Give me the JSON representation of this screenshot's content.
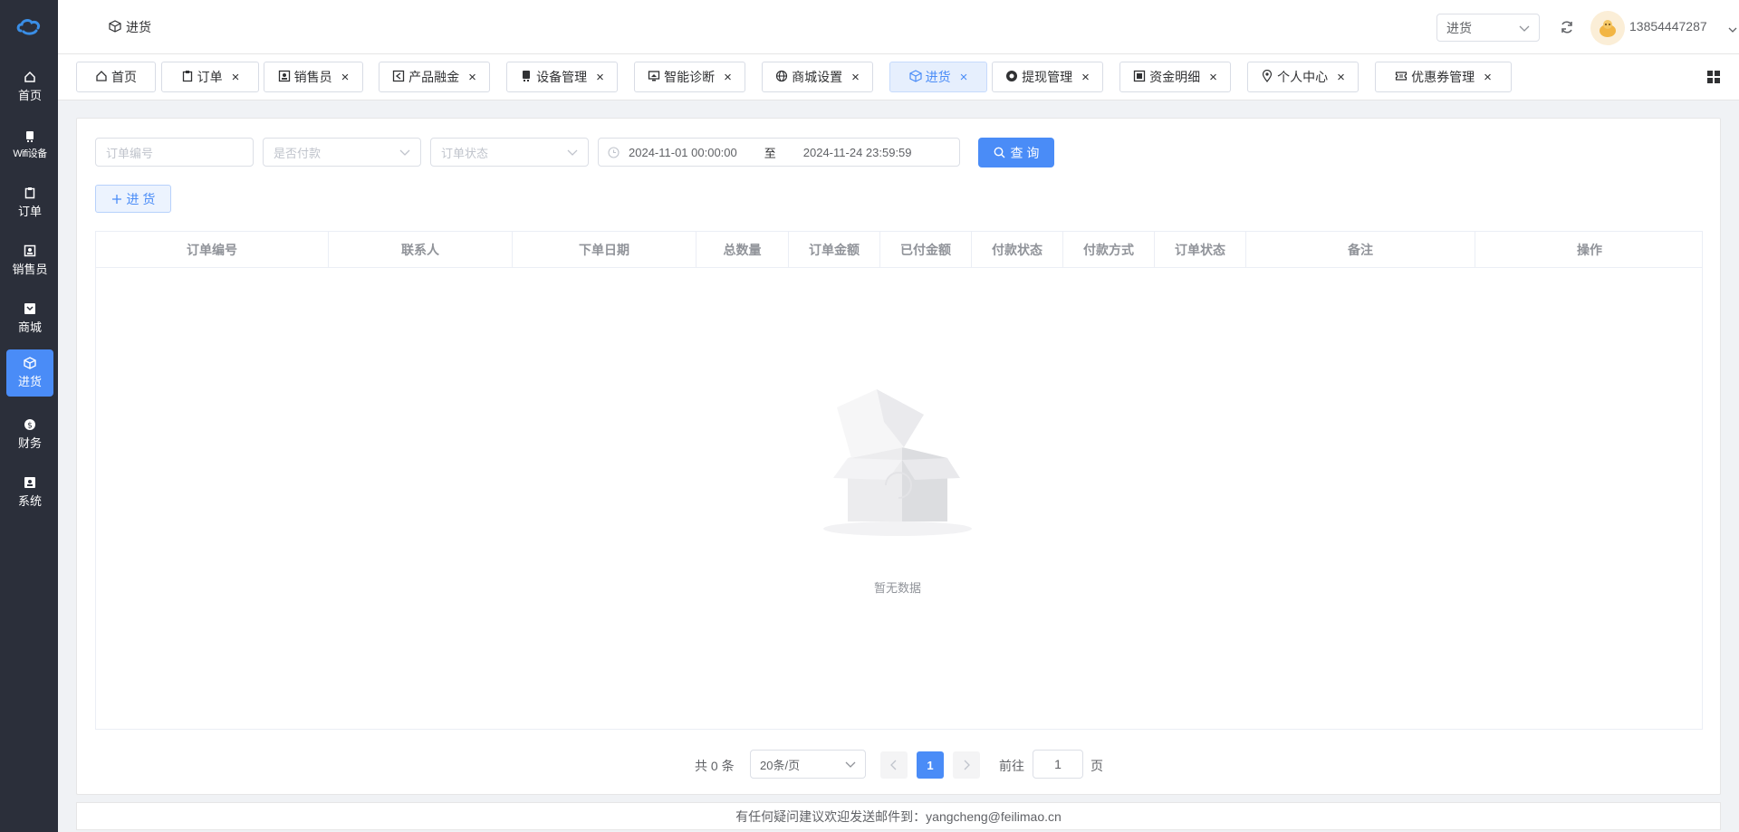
{
  "sidebar": {
    "logo_icon": "cloud-logo-icon",
    "items": [
      {
        "label": "首页",
        "icon": "home-icon"
      },
      {
        "label": "Wifi设备",
        "icon": "device-icon"
      },
      {
        "label": "订单",
        "icon": "clipboard-icon"
      },
      {
        "label": "销售员",
        "icon": "person-card-icon"
      },
      {
        "label": "商城",
        "icon": "shop-icon"
      },
      {
        "label": "进货",
        "icon": "cube-icon"
      },
      {
        "label": "财务",
        "icon": "money-icon"
      },
      {
        "label": "系统",
        "icon": "system-icon"
      }
    ],
    "active_index": 5
  },
  "header": {
    "breadcrumb": "进货",
    "select_value": "进货",
    "user_name": "13854447287"
  },
  "tabs": [
    {
      "label": "首页",
      "icon": "home-icon",
      "closable": false
    },
    {
      "label": "订单",
      "icon": "clipboard-icon",
      "closable": true
    },
    {
      "label": "销售员",
      "icon": "person-card-icon",
      "closable": true
    },
    {
      "label": "产品融金",
      "icon": "arrow-box-icon",
      "closable": true
    },
    {
      "label": "设备管理",
      "icon": "device-icon",
      "closable": true
    },
    {
      "label": "智能诊断",
      "icon": "monitor-icon",
      "closable": true
    },
    {
      "label": "商城设置",
      "icon": "globe-icon",
      "closable": true
    },
    {
      "label": "进货",
      "icon": "cube-icon",
      "closable": true,
      "active": true
    },
    {
      "label": "提现管理",
      "icon": "coin-icon",
      "closable": true
    },
    {
      "label": "资金明细",
      "icon": "ledger-icon",
      "closable": true
    },
    {
      "label": "个人中心",
      "icon": "location-pin-icon",
      "closable": true
    },
    {
      "label": "优惠券管理",
      "icon": "ticket-icon",
      "closable": true
    }
  ],
  "filters": {
    "order_no_placeholder": "订单编号",
    "paid_placeholder": "是否付款",
    "status_placeholder": "订单状态",
    "date_start": "2024-11-01 00:00:00",
    "date_sep": "至",
    "date_end": "2024-11-24 23:59:59",
    "query_label": "查 询",
    "add_label": "进 货"
  },
  "table": {
    "columns": [
      "订单编号",
      "联系人",
      "下单日期",
      "总数量",
      "订单金额",
      "已付金额",
      "付款状态",
      "付款方式",
      "订单状态",
      "备注",
      "操作"
    ],
    "rows": [],
    "empty_text": "暂无数据"
  },
  "pagination": {
    "total_text": "共 0 条",
    "page_size": "20条/页",
    "current_page": "1",
    "goto_label": "前往",
    "goto_value": "1",
    "page_unit": "页"
  },
  "footer": {
    "text": "有任何疑问建议欢迎发送邮件到：yangcheng@feilimao.cn"
  },
  "colors": {
    "accent": "#4a8cf7",
    "sidebar_bg": "#2b2f3a"
  }
}
